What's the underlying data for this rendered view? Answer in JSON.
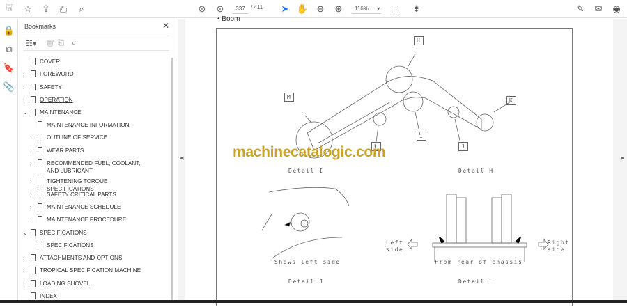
{
  "toolbar": {
    "page_current": "337",
    "page_total": "/ 411",
    "zoom": "116%",
    "icons": [
      "save-icon",
      "star-icon",
      "upload-icon",
      "print-icon",
      "search-icon",
      "prev-page-icon",
      "next-page-icon",
      "select-icon",
      "hand-icon",
      "zoom-out-icon",
      "zoom-in-icon",
      "fit-page-icon",
      "scroll-mode-icon",
      "sign-icon",
      "mail-icon",
      "account-icon"
    ]
  },
  "bookmarks": {
    "title": "Bookmarks",
    "items": [
      {
        "label": "COVER",
        "level": 0,
        "expand": ""
      },
      {
        "label": "FOREWORD",
        "level": 0,
        "expand": ">"
      },
      {
        "label": "SAFETY",
        "level": 0,
        "expand": ">"
      },
      {
        "label": "OPERATION",
        "level": 0,
        "expand": ">"
      },
      {
        "label": "MAINTENANCE",
        "level": 0,
        "expand": "v"
      },
      {
        "label": "MAINTENANCE INFORMATION",
        "level": 1,
        "expand": ""
      },
      {
        "label": "OUTLINE OF SERVICE",
        "level": 1,
        "expand": ">"
      },
      {
        "label": "WEAR PARTS",
        "level": 1,
        "expand": ">"
      },
      {
        "label": "RECOMMENDED FUEL, COOLANT, AND LUBRICANT",
        "level": 1,
        "expand": ">"
      },
      {
        "label": "TIGHTENING TORQUE SPECIFICATIONS",
        "level": 1,
        "expand": ">"
      },
      {
        "label": "SAFETY CRITICAL PARTS",
        "level": 1,
        "expand": ">"
      },
      {
        "label": "MAINTENANCE SCHEDULE",
        "level": 1,
        "expand": ">"
      },
      {
        "label": "MAINTENANCE PROCEDURE",
        "level": 1,
        "expand": ">"
      },
      {
        "label": "SPECIFICATIONS",
        "level": 0,
        "expand": "v"
      },
      {
        "label": "SPECIFICATIONS",
        "level": 1,
        "expand": ""
      },
      {
        "label": "ATTACHMENTS AND OPTIONS",
        "level": 0,
        "expand": ">"
      },
      {
        "label": "TROPICAL SPECIFICATION MACHINE",
        "level": 0,
        "expand": ">"
      },
      {
        "label": "LOADING SHOVEL",
        "level": 0,
        "expand": ">"
      },
      {
        "label": "INDEX",
        "level": 0,
        "expand": ""
      }
    ]
  },
  "doc": {
    "bullet": "• Boom",
    "callouts": {
      "h": "H",
      "m": "M",
      "k": "K",
      "i": "I",
      "j": "J",
      "l": "L"
    },
    "detail_i": "Detail I",
    "detail_h": "Detail H",
    "detail_j": "Detail J",
    "detail_l": "Detail L",
    "shows_left": "Shows left side",
    "from_rear": "From rear of chassis",
    "left_side": "Left side",
    "right_side": "Right side",
    "watermark": "machinecatalogic.com"
  }
}
